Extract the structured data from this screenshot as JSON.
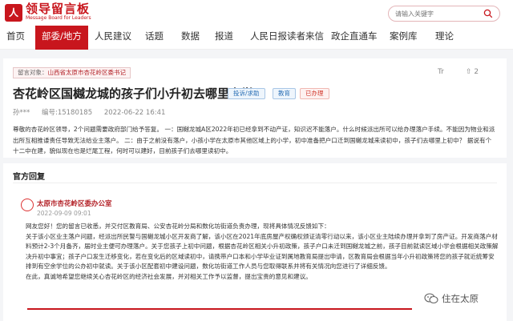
{
  "header": {
    "logo_mark": "人",
    "logo_cn": "领导留言板",
    "logo_en": "Message Board for Leaders",
    "search_placeholder": "请输入关键字",
    "search_icon": "search-icon"
  },
  "nav": {
    "items": [
      {
        "label": "首页",
        "active": false
      },
      {
        "label": "部委/地方",
        "active": true
      },
      {
        "label": "人民建议",
        "active": false
      },
      {
        "label": "话题",
        "active": false
      },
      {
        "label": "数据",
        "active": false
      },
      {
        "label": "报道",
        "active": false
      },
      {
        "label": "人民日报读者来信",
        "active": false
      },
      {
        "label": "政企直通车",
        "active": false
      },
      {
        "label": "案例库",
        "active": false
      },
      {
        "label": "理论",
        "active": false
      }
    ]
  },
  "message": {
    "recipient_label": "留言对象：",
    "recipient_value": "山西省太原市杏花岭区委书记",
    "font_icon": "Tr",
    "up_count": "2",
    "title": "杏花岭区国樾龙城的孩子们小升初去哪里上学",
    "tags": [
      "投诉/求助",
      "教育",
      "已办理"
    ],
    "author": "孙***",
    "id": "编号:15180185",
    "date": "2022-06-22 16:41",
    "content": "尊敬的杏花岭区领导，2个问题需要政府部门给予答复。 一：国樾龙城A区2022年初已经拿到不动产证，知识迟不能落户。什么时候派出所可以给办理落户手续。不能因为物业和派出所互相推诿责任导致无法给业主落户。 二：由于之前没有落户，小孩小学在太原市其他区域上的小学，初中准备把户口迁到国樾龙城来读初中，孩子们去哪里上初中？ 据说有个十二中在建，貌似现在也是烂尾工程，何时可以建好，目前孩子们去哪里读初中。"
  },
  "reply": {
    "heading": "官方回复",
    "org": "太原市杏花岭区委办公室",
    "date": "2022-09-09 09:01",
    "greeting": "网友您好！您的留言已收悉，并交付区教育局、公安杏花岭分局和数化坊街道负责办理，现将具体情况反馈如下：",
    "body": "关于该小区业主落户问题，经派出所民警与国樾龙城小区开发商了解，该小区在2021年底房屋产权确权颁证清零行动以来，该小区业主陆续办理并拿到了房产证。开发商落户材料预计2-3个月备齐，届时业主便可办理落户。关于您孩子上初中问题，根据杏花岭区相关小升初政策，孩子户口未迁到国樾龙城之前，孩子目前就读区域小学会根据相关政策解决升初中事宜；孩子户口发生迁移变化，若在变化后的区域读初中，请携带户口本和小学毕业证到属地教育局提出申请，区教育局会根据当年小升初政策将您的孩子就近统筹安排到有空余学位的公办初中就读。关于该小区配套初中建设问题，数化坊街道工作人员与您取得联系并将有关情况向您进行了详细反馈。",
    "closing": "在此，真诚地希望您继续关心杏花岭区的经济社会发展，并对相关工作予以监督，提出宝贵的意见和建议。"
  },
  "watermark": {
    "text": "住在太原"
  }
}
